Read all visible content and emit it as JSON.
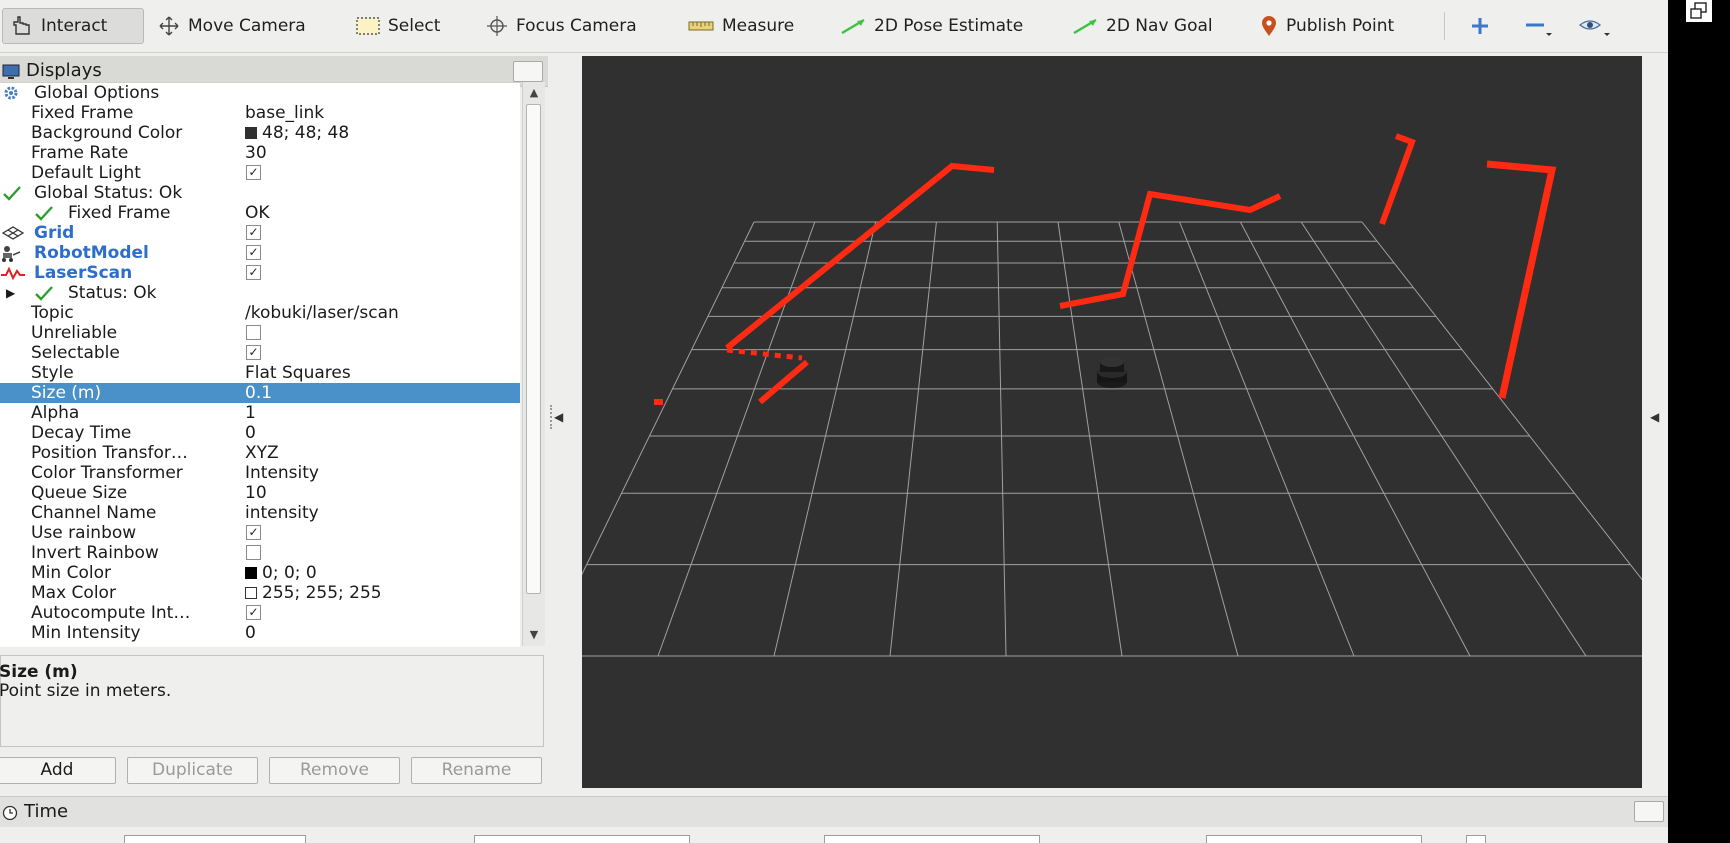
{
  "toolbar": {
    "interact": "Interact",
    "move_camera": "Move Camera",
    "select": "Select",
    "focus_camera": "Focus Camera",
    "measure": "Measure",
    "pose_estimate": "2D Pose Estimate",
    "nav_goal": "2D Nav Goal",
    "publish_point": "Publish Point"
  },
  "displays": {
    "title": "Displays",
    "rows": [
      {
        "name": "Global Options",
        "value": ""
      },
      {
        "name": "Fixed Frame",
        "value": "base_link"
      },
      {
        "name": "Background Color",
        "value": "48; 48; 48",
        "swatch": "#303030"
      },
      {
        "name": "Frame Rate",
        "value": "30"
      },
      {
        "name": "Default Light",
        "value": "",
        "checked": true
      },
      {
        "name": "Global Status: Ok",
        "value": ""
      },
      {
        "name": "Fixed Frame",
        "value": "OK"
      },
      {
        "name": "Grid",
        "value": "",
        "checked": true
      },
      {
        "name": "RobotModel",
        "value": "",
        "checked": true
      },
      {
        "name": "LaserScan",
        "value": "",
        "checked": true
      },
      {
        "name": "Status: Ok",
        "value": ""
      },
      {
        "name": "Topic",
        "value": "/kobuki/laser/scan"
      },
      {
        "name": "Unreliable",
        "value": "",
        "checked": false
      },
      {
        "name": "Selectable",
        "value": "",
        "checked": true
      },
      {
        "name": "Style",
        "value": "Flat Squares"
      },
      {
        "name": "Size (m)",
        "value": "0.1"
      },
      {
        "name": "Alpha",
        "value": "1"
      },
      {
        "name": "Decay Time",
        "value": "0"
      },
      {
        "name": "Position Transfor…",
        "value": "XYZ"
      },
      {
        "name": "Color Transformer",
        "value": "Intensity"
      },
      {
        "name": "Queue Size",
        "value": "10"
      },
      {
        "name": "Channel Name",
        "value": "intensity"
      },
      {
        "name": "Use rainbow",
        "value": "",
        "checked": true
      },
      {
        "name": "Invert Rainbow",
        "value": "",
        "checked": false
      },
      {
        "name": "Min Color",
        "value": "0; 0; 0",
        "swatch": "#000000"
      },
      {
        "name": "Max Color",
        "value": "255; 255; 255",
        "swatch": "#ffffff"
      },
      {
        "name": "Autocompute Int…",
        "value": "",
        "checked": true
      },
      {
        "name": "Min Intensity",
        "value": "0"
      }
    ],
    "description_title": "Size (m)",
    "description_text": "Point size in meters.",
    "buttons": {
      "add": "Add",
      "duplicate": "Duplicate",
      "remove": "Remove",
      "rename": "Rename"
    }
  },
  "time": {
    "title": "Time"
  },
  "colors": {
    "accent": "#4a90c9",
    "laser": "#ff2a12",
    "viewport_bg": "#303030"
  }
}
